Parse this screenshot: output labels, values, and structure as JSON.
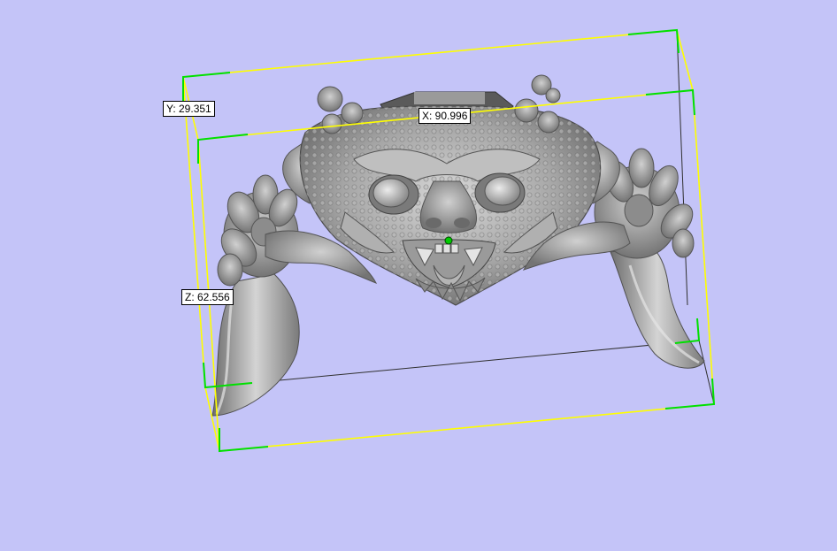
{
  "viewport": {
    "background_color": "#c4c4f8",
    "model_color": "#a3a3a3",
    "bbox_color": "#ffff00",
    "bbox_corner_color": "#00ff00",
    "pivot_color": "#00cc00"
  },
  "dimensions": {
    "x_label": "X: 90.996",
    "y_label": "Y: 29.351",
    "z_label": "Z: 62.556"
  },
  "model": {
    "name_icon": "demon-mask-icon"
  }
}
